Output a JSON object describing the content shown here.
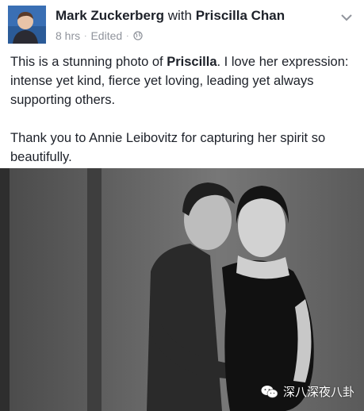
{
  "post": {
    "author": "Mark Zuckerberg",
    "with_word": "with",
    "tagged": "Priscilla Chan",
    "time": "8 hrs",
    "separator": "·",
    "edited": "Edited",
    "privacy_icon": "globe-icon",
    "menu_icon": "chevron-down-icon",
    "paragraph1_start": "This is a stunning photo of ",
    "paragraph1_name": "Priscilla",
    "paragraph1_end": ". I love her expression: intense yet kind, fierce yet loving, leading yet always supporting others.",
    "paragraph2": "Thank you to Annie Leibovitz for capturing her spirit so beautifully."
  },
  "photo": {
    "watermark": "深八深夜八卦",
    "watermark_icon": "wechat-icon"
  },
  "colors": {
    "text": "#1d2129",
    "meta": "#90949c",
    "avatar_bg": "#3a6fb4",
    "photo_bg": "#3c3c3c"
  }
}
